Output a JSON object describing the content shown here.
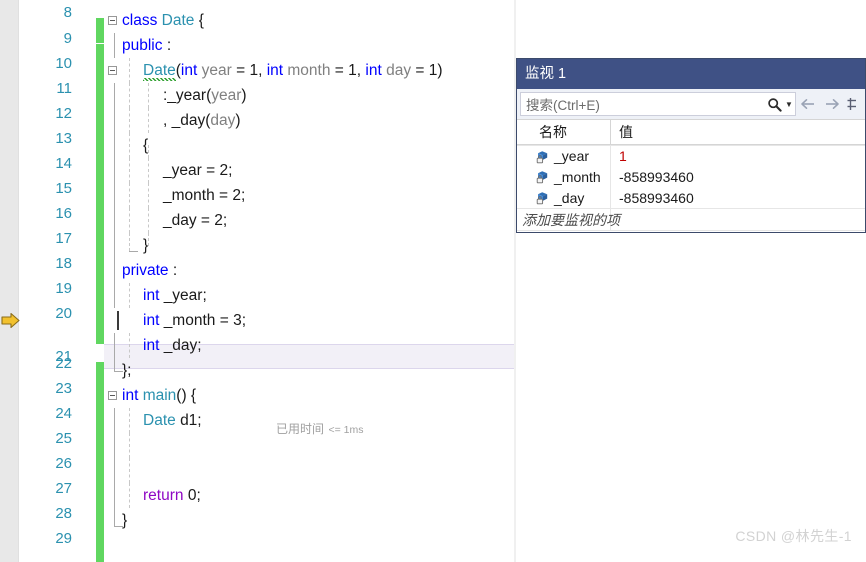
{
  "editor": {
    "start_line_partial": "8",
    "lines": [
      {
        "num": "9",
        "text": "class Date {"
      },
      {
        "num": "10",
        "text": "public :"
      },
      {
        "num": "11",
        "text": "Date(int year = 1, int month = 1, int day = 1)"
      },
      {
        "num": "12",
        "text": ":_year(year)"
      },
      {
        "num": "13",
        "text": ", _day(day)"
      },
      {
        "num": "14",
        "text": "{"
      },
      {
        "num": "15",
        "text": "_year = 2;"
      },
      {
        "num": "16",
        "text": "_month = 2;"
      },
      {
        "num": "17",
        "text": "_day = 2;"
      },
      {
        "num": "18",
        "text": "}"
      },
      {
        "num": "19",
        "text": "private :"
      },
      {
        "num": "20",
        "text": "int _year;"
      },
      {
        "num": "21",
        "text": "int _month = 3;"
      },
      {
        "num": "22",
        "text": "int _day;"
      },
      {
        "num": "23",
        "text": "};"
      },
      {
        "num": "24",
        "text": "int main() {"
      },
      {
        "num": "25",
        "text": "Date d1;"
      },
      {
        "num": "26",
        "text": ""
      },
      {
        "num": "27",
        "text": ""
      },
      {
        "num": "28",
        "text": "return 0;"
      },
      {
        "num": "29",
        "text": "}"
      }
    ],
    "current_line": "21",
    "elapsed_label": "已用时间",
    "elapsed_value": "<= 1ms",
    "tokens": {
      "kw_class": "class",
      "type_date": "Date",
      "kw_public": "public",
      "kw_private": "private",
      "kw_int": "int",
      "kw_return": "return",
      "ident_main": "main",
      "ident_d1": "d1",
      "param_year": "year",
      "param_month": "month",
      "param_day": "day",
      "field_year": "_year",
      "field_month": "_month",
      "field_day": "_day"
    },
    "colors": {
      "keyword": "#0000FF",
      "type": "#2B91AF",
      "parameter": "#808080",
      "control": "#8F08C4",
      "plain": "#1A1A1A",
      "line_number": "#2B91AF",
      "change_bar": "#60D760",
      "squiggle": "#2E9F2E",
      "current_line_bg": "#F2F0F7"
    }
  },
  "watch": {
    "title": "监视 1",
    "search": {
      "placeholder": "搜索(Ctrl+E)",
      "icon": "search-icon",
      "dropdown_icon": "chevron-down-icon"
    },
    "toolbar": {
      "back_icon": "arrow-left-icon",
      "forward_icon": "arrow-right-icon",
      "extra_icon": "columns-icon"
    },
    "columns": [
      "名称",
      "值"
    ],
    "rows": [
      {
        "icon": "private-field-icon",
        "name": "_year",
        "value": "1",
        "changed": true
      },
      {
        "icon": "private-field-icon",
        "name": "_month",
        "value": "-858993460",
        "changed": false
      },
      {
        "icon": "private-field-icon",
        "name": "_day",
        "value": "-858993460",
        "changed": false
      }
    ],
    "add_item_prompt": "添加要监视的项",
    "colors": {
      "title_bar": "#3F5185",
      "changed_value": "#C00000"
    }
  },
  "watermark": {
    "text": "CSDN @林先生-1"
  }
}
